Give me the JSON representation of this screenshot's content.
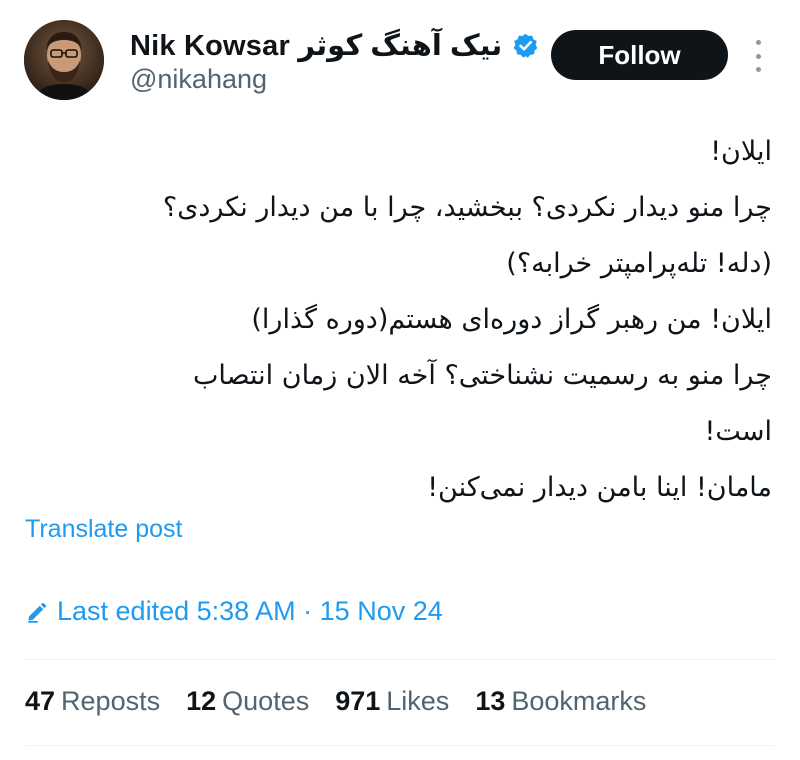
{
  "author": {
    "display_name": "Nik Kowsar نیک آهنگ کوثر",
    "handle": "@nikahang",
    "verified_icon": "verified-badge-icon",
    "avatar": "avatar-photo"
  },
  "header": {
    "follow_label": "Follow",
    "more_icon": "more-vertical-icon"
  },
  "tweet": {
    "lines": [
      "ایلان!",
      "چرا منو دیدار نکردی؟ ببخشید، چرا با من دیدار نکردی؟",
      "(دله! تله‌پرامپتر خرابه؟)",
      "ایلان! من رهبر گراز دوره‌ای هستم(دوره گذارا)",
      "چرا منو به رسمیت نشناختی؟ آخه الان زمان انتصاب",
      "است!",
      "مامان! اینا بامن دیدار نمی‌کنن!"
    ]
  },
  "translate_label": "Translate post",
  "edited": {
    "text": "Last edited 5:38 AM · 15 Nov 24",
    "icon": "pencil-icon"
  },
  "stats": {
    "reposts_value": "47",
    "reposts_label": "Reposts",
    "quotes_value": "12",
    "quotes_label": "Quotes",
    "likes_value": "971",
    "likes_label": "Likes",
    "bookmarks_value": "13",
    "bookmarks_label": "Bookmarks"
  },
  "colors": {
    "accent": "#1d9bf0",
    "text_primary": "#0f1419",
    "text_secondary": "#536471",
    "follow_bg": "#0f1419"
  }
}
